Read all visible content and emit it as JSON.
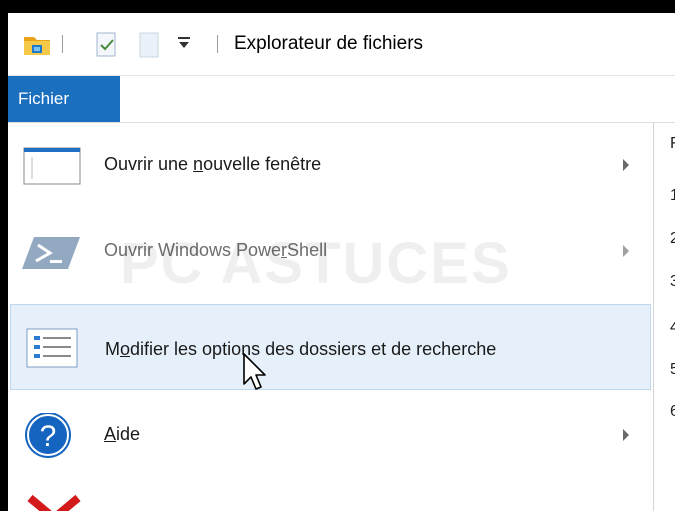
{
  "window": {
    "title": "Explorateur de fichiers"
  },
  "ribbon": {
    "active_tab": "Fichier"
  },
  "menu": {
    "items": [
      {
        "label_pre": "Ouvrir une ",
        "label_key": "n",
        "label_post": "ouvelle fenêtre",
        "icon": "new-window-icon",
        "submenu": true,
        "enabled": true
      },
      {
        "label_pre": "Ouvrir Windows Powe",
        "label_key": "r",
        "label_post": "Shell",
        "icon": "powershell-icon",
        "submenu": true,
        "enabled": false
      },
      {
        "label_pre": "M",
        "label_key": "o",
        "label_post": "difier les options des dossiers et de recherche",
        "icon": "folder-options-icon",
        "submenu": false,
        "enabled": true,
        "hovered": true
      },
      {
        "label_pre": "",
        "label_key": "A",
        "label_post": "ide",
        "icon": "help-icon",
        "submenu": true,
        "enabled": true
      },
      {
        "icon": "close-icon",
        "partial": true
      }
    ]
  },
  "right_pane": {
    "header": "F",
    "numbers": [
      "1",
      "2",
      "3",
      "4",
      "5",
      "6"
    ]
  },
  "watermark": "PC ASTUCES",
  "colors": {
    "ribbon_blue": "#1a6fbf",
    "hover_bg": "#e5f0fa",
    "hover_border": "#c0d8ee",
    "help_blue": "#1565c0",
    "close_red": "#d31a1a"
  }
}
